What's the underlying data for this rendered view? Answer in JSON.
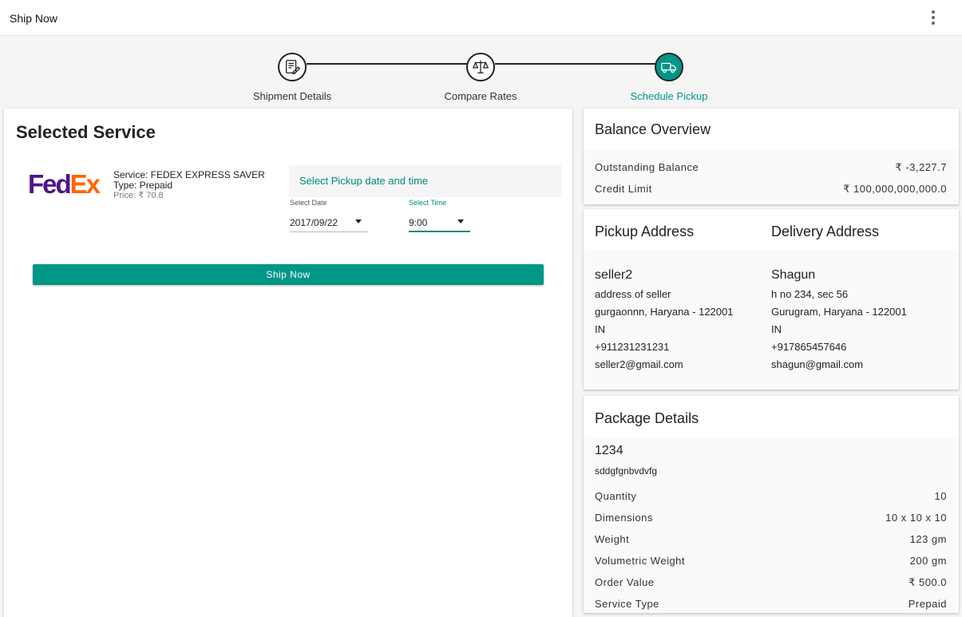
{
  "app": {
    "title": "Ship Now"
  },
  "stepper": {
    "steps": [
      {
        "label": "Shipment Details",
        "icon": "edit-document-icon",
        "active": false
      },
      {
        "label": "Compare Rates",
        "icon": "scales-icon",
        "active": false
      },
      {
        "label": "Schedule Pickup",
        "icon": "truck-icon",
        "active": true
      }
    ]
  },
  "selected_service": {
    "heading": "Selected Service",
    "carrier_logo": {
      "part1": "Fed",
      "part2": "Ex"
    },
    "service": "Service: FEDEX EXPRESS SAVER",
    "type": "Type: Prepaid",
    "price": "Price: ₹ 70.8",
    "pickup_prompt": "Select Pickup date and time",
    "date_label": "Select Date",
    "date_value": "2017/09/22",
    "time_label": "Select Time",
    "time_value": "9:00",
    "ship_button": "Ship Now"
  },
  "balance": {
    "heading": "Balance Overview",
    "outstanding_label": "Outstanding Balance",
    "outstanding_value": "₹ -3,227.7",
    "credit_label": "Credit Limit",
    "credit_value": "₹ 100,000,000,000.0"
  },
  "addresses": {
    "pickup_heading": "Pickup Address",
    "delivery_heading": "Delivery Address",
    "pickup": {
      "name": "seller2",
      "line1": "address of seller",
      "line2": "gurgaonnn, Haryana - 122001",
      "country": "IN",
      "phone": "+911231231231",
      "email": "seller2@gmail.com"
    },
    "delivery": {
      "name": "Shagun",
      "line1": "h no 234, sec 56",
      "line2": "Gurugram, Haryana - 122001",
      "country": "IN",
      "phone": "+917865457646",
      "email": "shagun@gmail.com"
    }
  },
  "package": {
    "heading": "Package Details",
    "id": "1234",
    "description": "sddgfgnbvdvfg",
    "rows": [
      {
        "label": "Quantity",
        "value": "10"
      },
      {
        "label": "Dimensions",
        "value": "10 x 10 x 10"
      },
      {
        "label": "Weight",
        "value": "123 gm"
      },
      {
        "label": "Volumetric Weight",
        "value": "200 gm"
      },
      {
        "label": "Order Value",
        "value": "₹ 500.0"
      },
      {
        "label": "Service Type",
        "value": "Prepaid"
      }
    ]
  },
  "colors": {
    "accent": "#009688",
    "fedex_purple": "#4d148c",
    "fedex_orange": "#ff6600"
  }
}
